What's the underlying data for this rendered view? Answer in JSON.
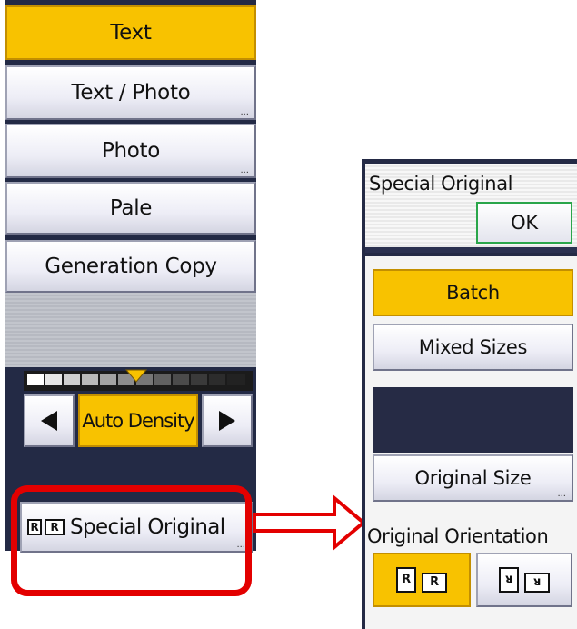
{
  "left_panel": {
    "modes": [
      {
        "label": "Text",
        "selected": true,
        "has_more": false
      },
      {
        "label": "Text / Photo",
        "selected": false,
        "has_more": true
      },
      {
        "label": "Photo",
        "selected": false,
        "has_more": true
      },
      {
        "label": "Pale",
        "selected": false,
        "has_more": false
      },
      {
        "label": "Generation Copy",
        "selected": false,
        "has_more": false
      }
    ],
    "density": {
      "decrease_icon": "triangle-left-icon",
      "increase_icon": "triangle-right-icon",
      "auto_label": "Auto Density",
      "indicator_icon": "triangle-down-icon"
    },
    "special_original": {
      "icon": "orientation-r-icon",
      "label": "Special Original",
      "more": "..."
    }
  },
  "right_panel": {
    "title": "Special Original",
    "ok_label": "OK",
    "batch_label": "Batch",
    "mixed_sizes_label": "Mixed Sizes",
    "original_size_label": "Original Size",
    "orientation_label": "Original Orientation",
    "orientation_options": [
      {
        "icon": "readable-orientation-icon",
        "selected": true
      },
      {
        "icon": "unreadable-orientation-icon",
        "selected": false
      }
    ],
    "more": "..."
  },
  "colors": {
    "selected": "#f8c200",
    "highlight": "#e30000",
    "panel_dark": "#232a45",
    "ok_border": "#2aa64a"
  }
}
